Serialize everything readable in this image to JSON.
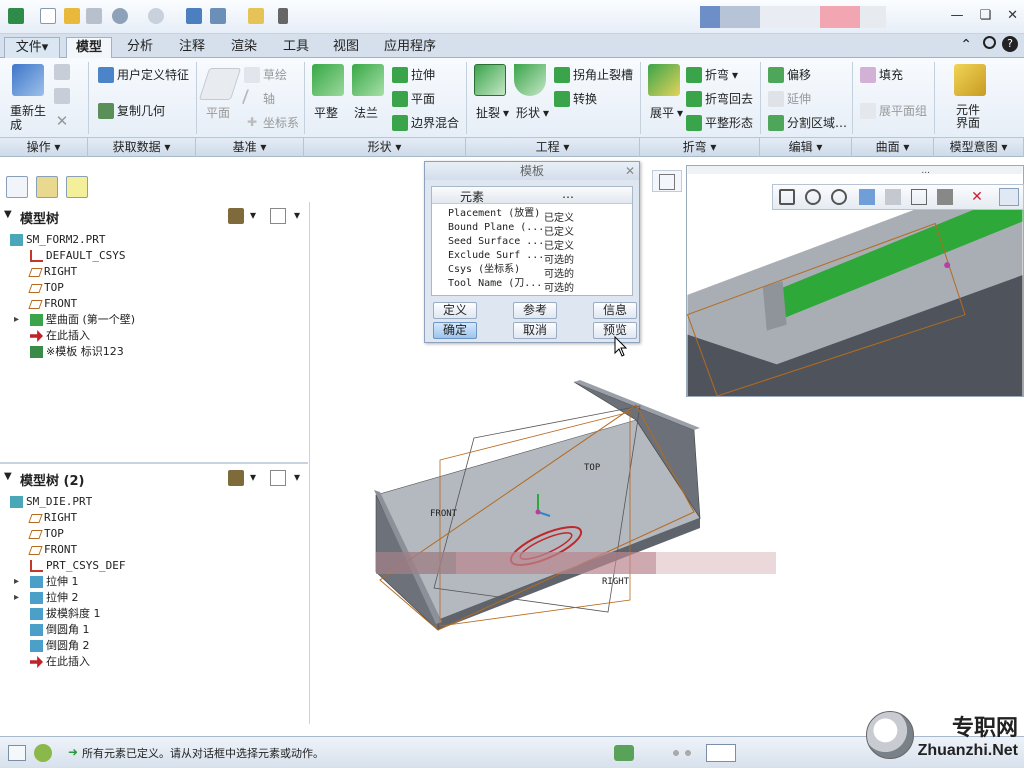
{
  "window": {
    "minimize": "—",
    "restore": "❏",
    "close": "✕"
  },
  "tabs": [
    {
      "label": "文件",
      "dropdown": "▾"
    },
    {
      "label": "模型"
    },
    {
      "label": "分析"
    },
    {
      "label": "注释"
    },
    {
      "label": "渲染"
    },
    {
      "label": "工具"
    },
    {
      "label": "视图"
    },
    {
      "label": "应用程序"
    }
  ],
  "ribbon": {
    "regen_label_1": "重新生",
    "regen_label_2": "成",
    "user_feature": "用户定义特征",
    "copy_geom": "复制几何",
    "plane": "平面",
    "sketch": "草绘",
    "axis": "轴",
    "csys": "坐标系",
    "flat": "平整",
    "flange": "法兰",
    "extrude": "拉伸",
    "planar": "平面",
    "boundary_blend": "边界混合",
    "rip": "扯裂",
    "form": "形状",
    "corner_relief": "拐角止裂槽",
    "convert": "转换",
    "unbend": "展平",
    "bend": "折弯",
    "bend_back": "折弯回去",
    "flat_state": "平整形态",
    "offset": "偏移",
    "extend": "延伸",
    "split_area": "分割区域…",
    "fill": "填充",
    "flatten_quilt": "展平面组",
    "component_interface_1": "元件",
    "component_interface_2": "界面"
  },
  "groups": [
    "操作",
    "获取数据",
    "基准",
    "形状",
    "工程",
    "折弯",
    "编辑",
    "曲面",
    "模型意图"
  ],
  "dropdown_arrow": "▾",
  "model_tree_1": {
    "title": "模型树",
    "items": [
      {
        "label": "SM_FORM2.PRT",
        "icon": "part-icon"
      },
      {
        "label": "DEFAULT_CSYS",
        "icon": "csys-icon"
      },
      {
        "label": "RIGHT",
        "icon": "datum-plane-icon"
      },
      {
        "label": "TOP",
        "icon": "datum-plane-icon"
      },
      {
        "label": "FRONT",
        "icon": "datum-plane-icon"
      },
      {
        "label": "壁曲面 (第一个壁)",
        "icon": "wall-icon",
        "expand": "▸"
      },
      {
        "label": "在此插入",
        "icon": "insert-arrow-icon"
      },
      {
        "label": "※模板 标识123",
        "icon": "template-icon"
      }
    ]
  },
  "model_tree_2": {
    "title": "模型树 (2)",
    "items": [
      {
        "label": "SM_DIE.PRT",
        "icon": "part-icon"
      },
      {
        "label": "RIGHT",
        "icon": "datum-plane-icon"
      },
      {
        "label": "TOP",
        "icon": "datum-plane-icon"
      },
      {
        "label": "FRONT",
        "icon": "datum-plane-icon"
      },
      {
        "label": "PRT_CSYS_DEF",
        "icon": "csys-icon"
      },
      {
        "label": "拉伸 1",
        "icon": "extrude-icon",
        "expand": "▸"
      },
      {
        "label": "拉伸 2",
        "icon": "extrude-icon",
        "expand": "▸"
      },
      {
        "label": "拔模斜度 1",
        "icon": "draft-icon"
      },
      {
        "label": "倒圆角 1",
        "icon": "round-icon"
      },
      {
        "label": "倒圆角 2",
        "icon": "round-icon"
      },
      {
        "label": "在此插入",
        "icon": "insert-arrow-icon"
      }
    ]
  },
  "dialog": {
    "title": "模板",
    "close": "✕",
    "col_element": "元素",
    "col_info": "…",
    "rows": [
      {
        "element": "Placement (放置)",
        "status": "已定义"
      },
      {
        "element": "Bound Plane (...",
        "status": "已定义"
      },
      {
        "element": "Seed Surface ...",
        "status": "已定义"
      },
      {
        "element": "Exclude Surf ...",
        "status": "可选的"
      },
      {
        "element": "Csys (坐标系)",
        "status": "可选的"
      },
      {
        "element": "Tool Name (刀...",
        "status": "可选的"
      }
    ],
    "btn_define": "定义",
    "btn_refs": "参考",
    "btn_info": "信息",
    "btn_ok": "确定",
    "btn_cancel": "取消",
    "btn_preview": "预览"
  },
  "viewport_labels": {
    "front": "FRONT",
    "top": "TOP",
    "right": "RIGHT"
  },
  "subwindow": {
    "title_dots": "..."
  },
  "status": {
    "message": "所有元素已定义。请从对话框中选择元素或动作。"
  },
  "watermark": {
    "brand": "专职网",
    "url": "Zhuanzhi.Net"
  },
  "colors": {
    "accent_blue": "#4a78b0",
    "green_form": "#2fa83a",
    "model_gray": "#6b7079"
  }
}
